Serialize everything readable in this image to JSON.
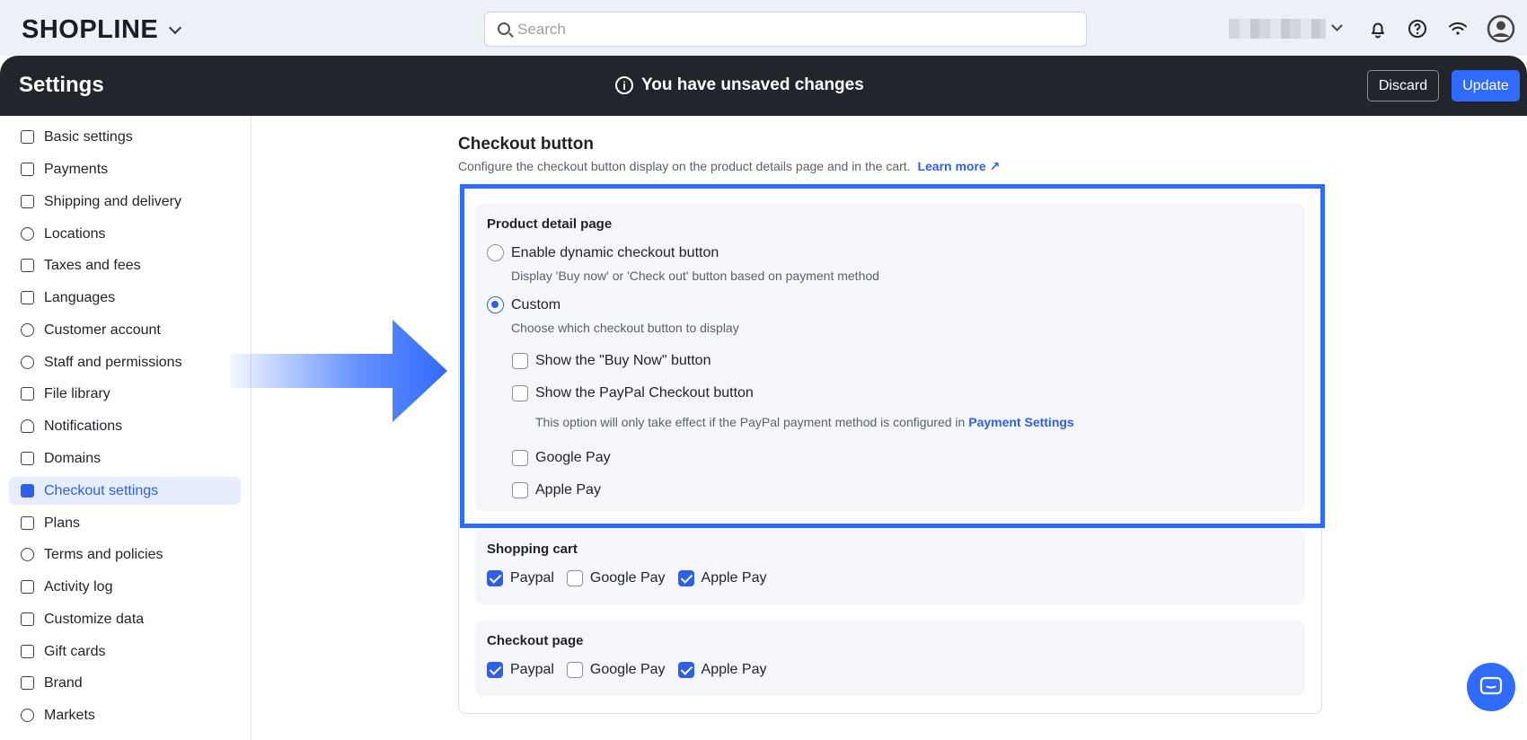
{
  "topbar": {
    "logo": "SHOPLINE",
    "search_placeholder": "Search"
  },
  "header": {
    "title": "Settings",
    "unsaved_message": "You have unsaved changes",
    "discard_label": "Discard",
    "update_label": "Update"
  },
  "sidebar": {
    "items": [
      {
        "label": "Basic settings",
        "icon": "settings-icon"
      },
      {
        "label": "Payments",
        "icon": "payments-icon"
      },
      {
        "label": "Shipping and delivery",
        "icon": "truck-icon"
      },
      {
        "label": "Locations",
        "icon": "location-pin-icon"
      },
      {
        "label": "Taxes and fees",
        "icon": "receipt-icon"
      },
      {
        "label": "Languages",
        "icon": "languages-icon"
      },
      {
        "label": "Customer account",
        "icon": "person-icon"
      },
      {
        "label": "Staff and permissions",
        "icon": "staff-icon"
      },
      {
        "label": "File library",
        "icon": "folder-icon"
      },
      {
        "label": "Notifications",
        "icon": "bell-icon"
      },
      {
        "label": "Domains",
        "icon": "domain-icon"
      },
      {
        "label": "Checkout settings",
        "icon": "shopping-bag-icon",
        "active": true
      },
      {
        "label": "Plans",
        "icon": "plans-icon"
      },
      {
        "label": "Terms and policies",
        "icon": "info-icon"
      },
      {
        "label": "Activity log",
        "icon": "log-icon"
      },
      {
        "label": "Customize data",
        "icon": "code-braces-icon"
      },
      {
        "label": "Gift cards",
        "icon": "gift-card-icon"
      },
      {
        "label": "Brand",
        "icon": "brand-icon"
      },
      {
        "label": "Markets",
        "icon": "globe-icon"
      }
    ]
  },
  "checkout": {
    "title": "Checkout button",
    "description": "Configure the checkout button display on the product details page and in the cart.",
    "learn_more": "Learn more",
    "product_detail": {
      "title": "Product detail page",
      "dynamic_label": "Enable dynamic checkout button",
      "dynamic_desc": "Display 'Buy now' or 'Check out' button based on payment method",
      "custom_label": "Custom",
      "custom_desc": "Choose which checkout button to display",
      "buy_now_label": "Show the \"Buy Now\" button",
      "paypal_label": "Show the PayPal Checkout button",
      "paypal_note": "This option will only take effect if the PayPal payment method is configured in",
      "paypal_note_link": "Payment Settings",
      "google_pay_label": "Google Pay",
      "apple_pay_label": "Apple Pay"
    },
    "shopping_cart": {
      "title": "Shopping cart",
      "paypal": "Paypal",
      "google_pay": "Google Pay",
      "apple_pay": "Apple Pay"
    },
    "checkout_page": {
      "title": "Checkout page",
      "paypal": "Paypal",
      "google_pay": "Google Pay",
      "apple_pay": "Apple Pay"
    }
  },
  "colors": {
    "accent": "#2f6bff",
    "header_bg": "#22252c",
    "topbar_bg": "#eef0f8",
    "highlight_border": "#2f6bff"
  }
}
